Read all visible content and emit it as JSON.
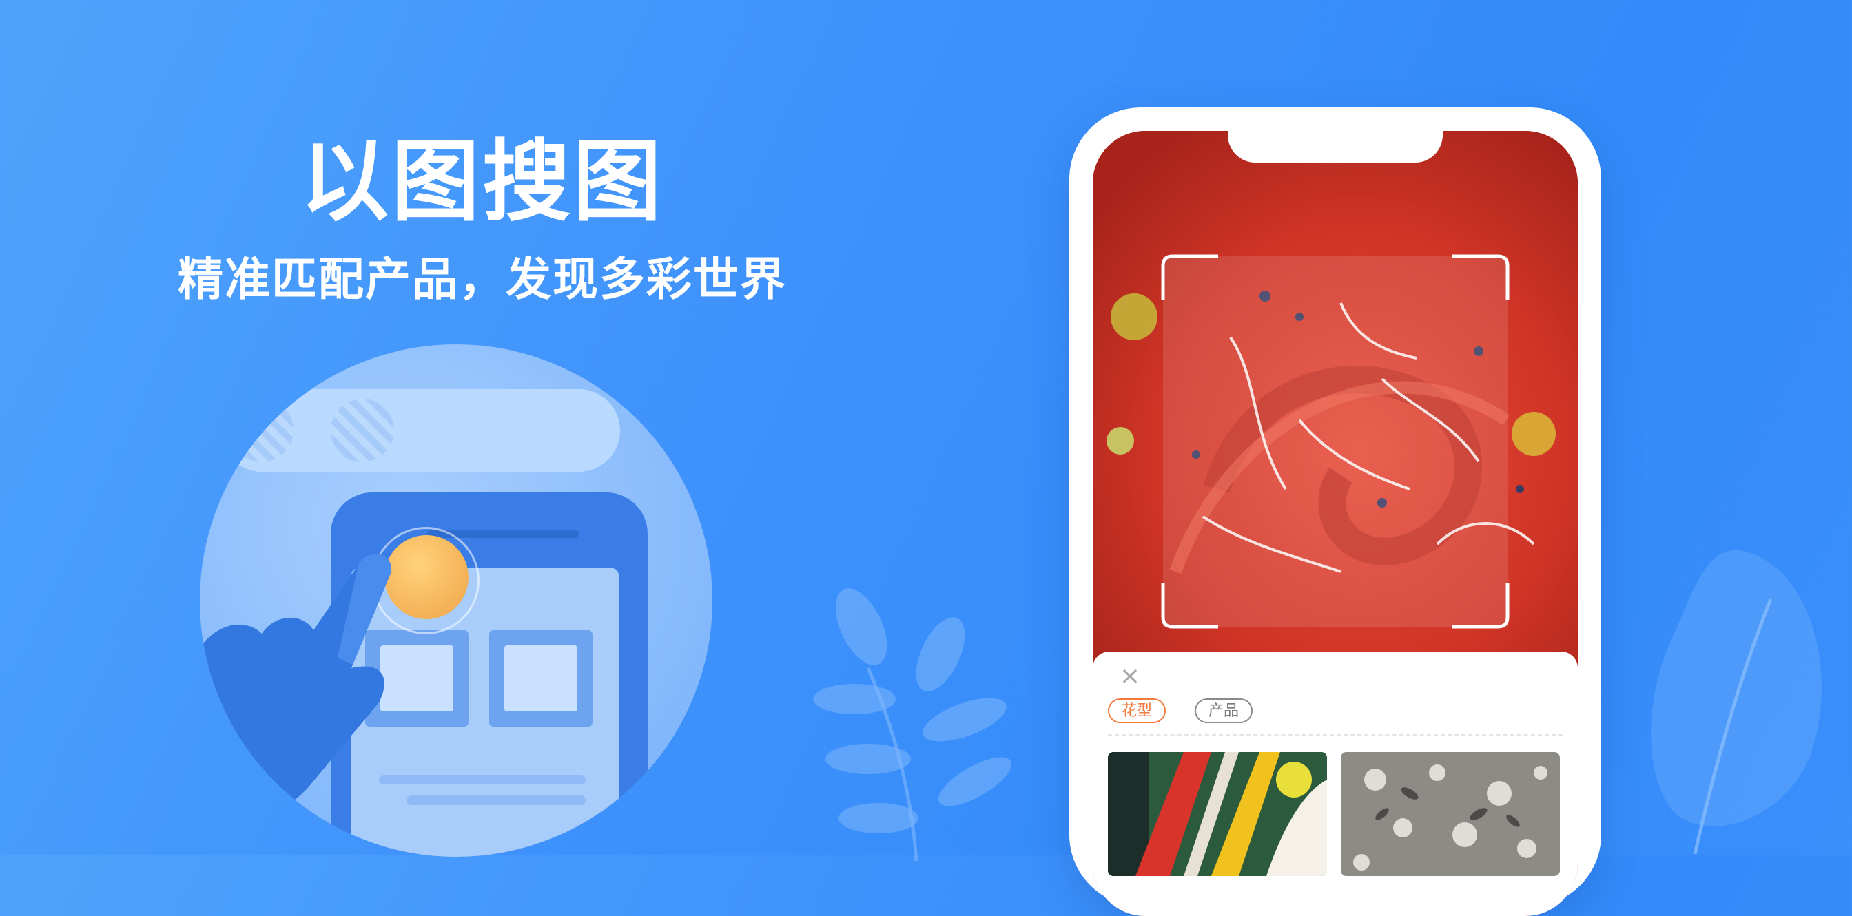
{
  "hero": {
    "title": "以图搜图",
    "subtitle": "精准匹配产品，发现多彩世界"
  },
  "result_panel": {
    "close_icon": "close-icon",
    "tabs": [
      {
        "label": "花型",
        "active": true
      },
      {
        "label": "产品",
        "active": false
      }
    ],
    "results": [
      {
        "kind": "fabric-swatch-multicolor"
      },
      {
        "kind": "fabric-swatch-gray-floral"
      }
    ]
  },
  "colors": {
    "background": "#3f92fb",
    "accent_orange": "#f47a3c",
    "fabric_red": "#d9362a"
  }
}
